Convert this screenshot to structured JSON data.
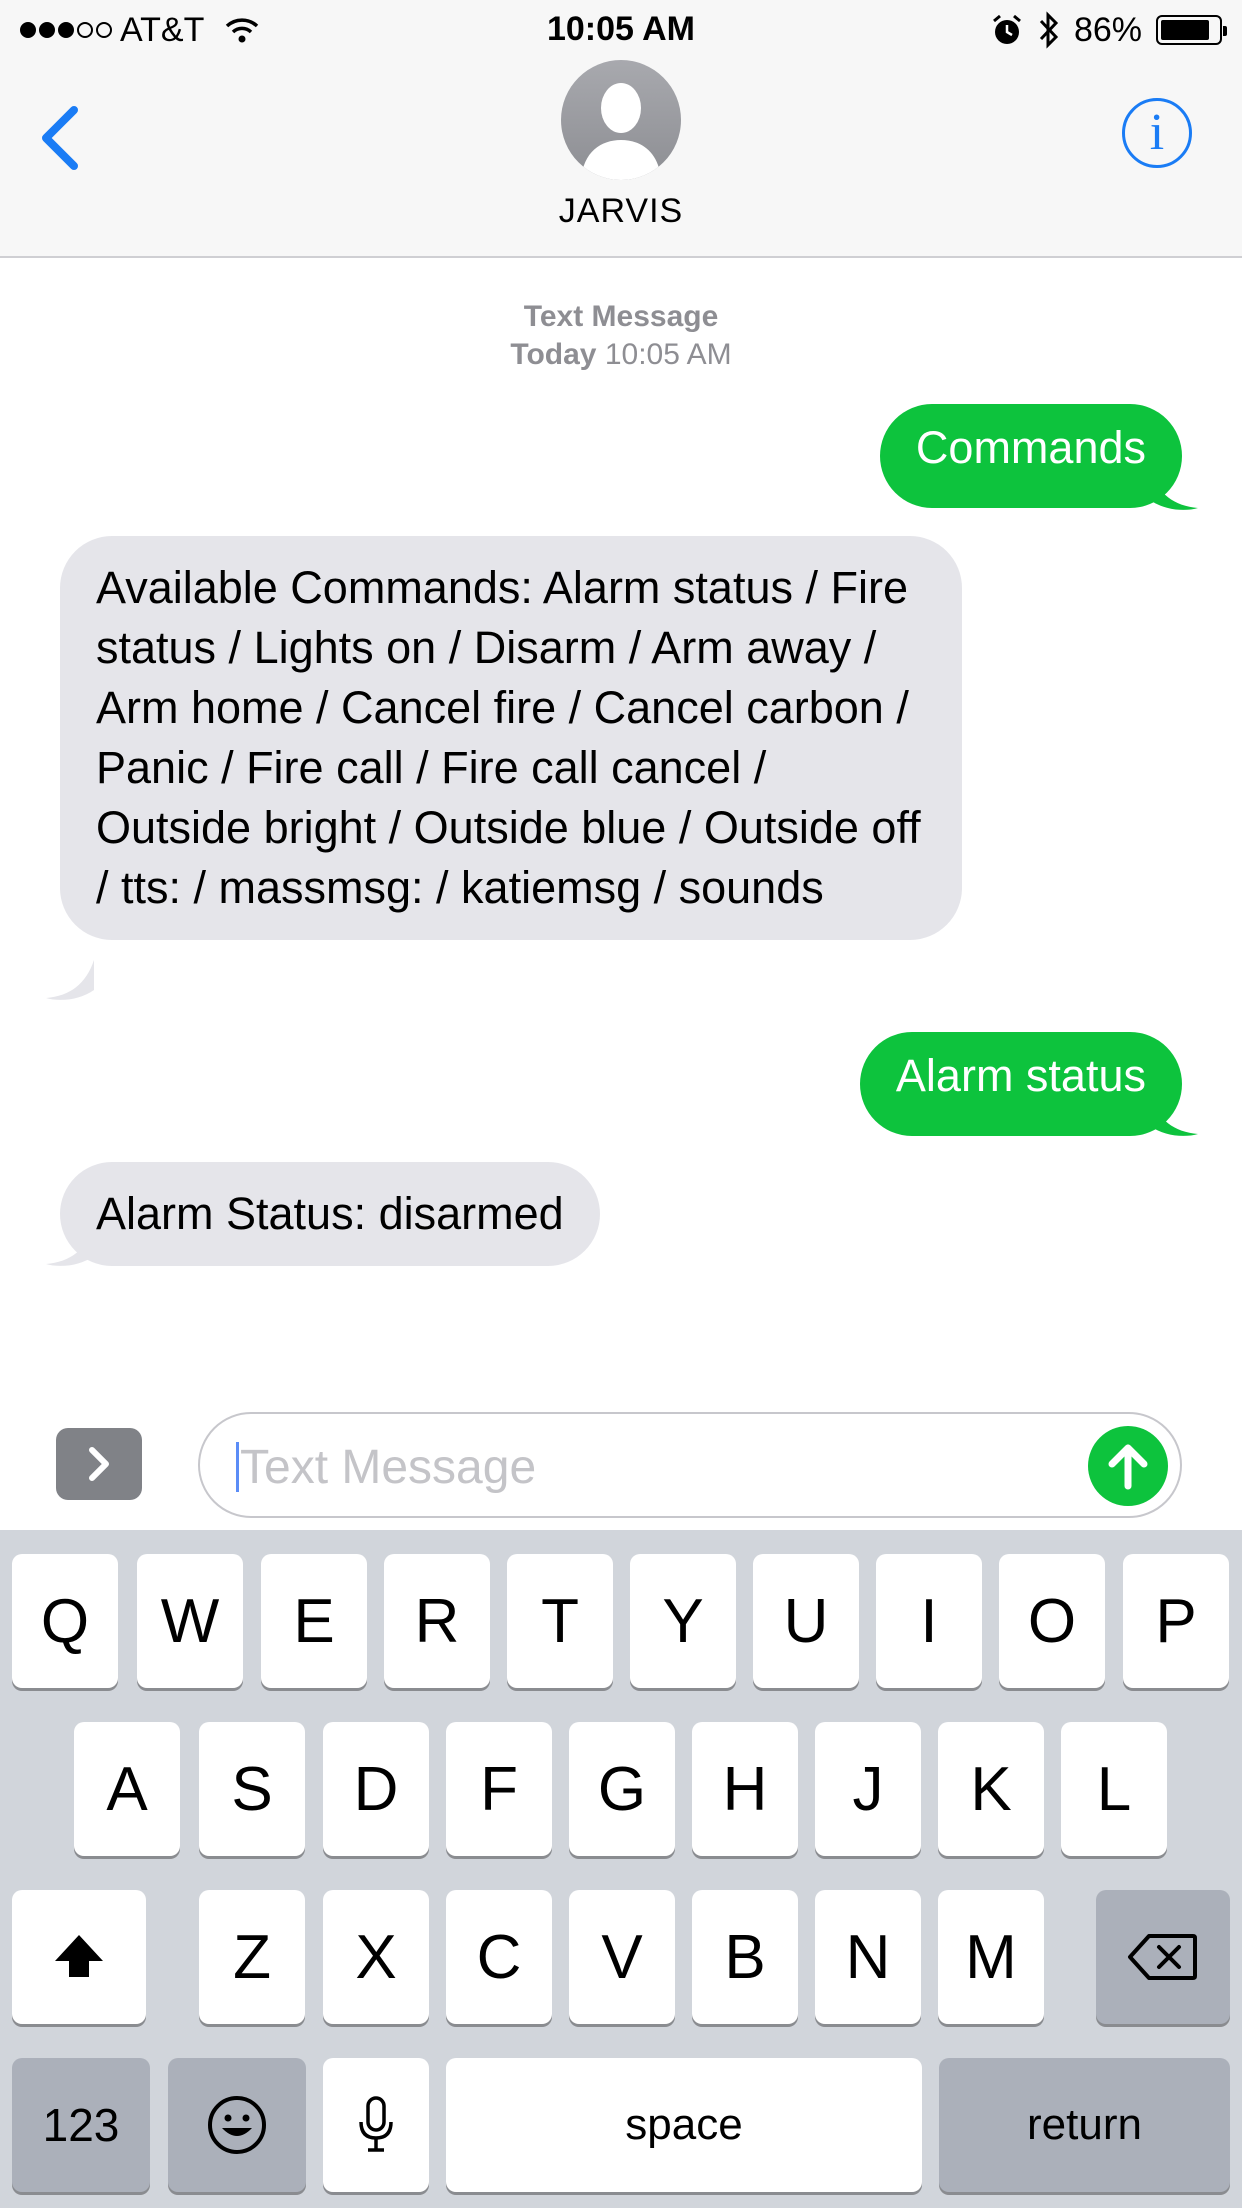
{
  "status_bar": {
    "carrier": "AT&T",
    "time": "10:05 AM",
    "battery": "86%",
    "battery_level": 0.86
  },
  "header": {
    "back_icon": "chevron-left-icon",
    "contact_name": "JARVIS",
    "info_icon": "info-icon",
    "info_glyph": "i"
  },
  "conversation": {
    "service_label": "Text Message",
    "day_label": "Today",
    "time_label": "10:05 AM",
    "messages": [
      {
        "direction": "sent",
        "text": "Commands"
      },
      {
        "direction": "received",
        "text": "Available Commands: Alarm status / Fire status / Lights on / Disarm / Arm away / Arm home / Cancel fire / Cancel carbon / Panic / Fire call / Fire call cancel / Outside bright / Outside blue / Outside off / tts: / massmsg: / katiemsg / sounds"
      },
      {
        "direction": "sent",
        "text": "Alarm status"
      },
      {
        "direction": "received",
        "text": "Alarm Status: disarmed"
      }
    ]
  },
  "composer": {
    "placeholder": "Text Message",
    "value": ""
  },
  "keyboard": {
    "row1": [
      "Q",
      "W",
      "E",
      "R",
      "T",
      "Y",
      "U",
      "I",
      "O",
      "P"
    ],
    "row2": [
      "A",
      "S",
      "D",
      "F",
      "G",
      "H",
      "J",
      "K",
      "L"
    ],
    "row3": [
      "Z",
      "X",
      "C",
      "V",
      "B",
      "N",
      "M"
    ],
    "numbers_label": "123",
    "space_label": "space",
    "return_label": "return"
  },
  "colors": {
    "sent_bubble": "#0dc33d",
    "received_bubble": "#e5e5ea",
    "accent": "#1a7cf5"
  }
}
